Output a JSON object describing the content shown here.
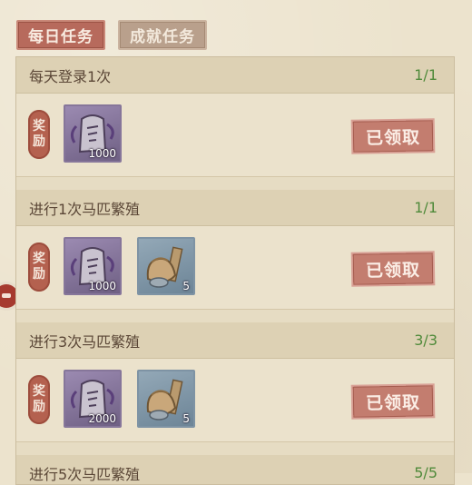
{
  "tabs": [
    {
      "label": "每日任务",
      "active": true
    },
    {
      "label": "成就任务",
      "active": false
    }
  ],
  "reward_label": [
    "奖",
    "励"
  ],
  "tasks": [
    {
      "title": "每天登录1次",
      "progress": "1/1",
      "status": "已领取",
      "rewards": [
        {
          "icon": "purple-token-icon",
          "count": "1000"
        }
      ]
    },
    {
      "title": "进行1次马匹繁殖",
      "progress": "1/1",
      "status": "已领取",
      "rewards": [
        {
          "icon": "purple-token-icon",
          "count": "1000"
        },
        {
          "icon": "feed-sack-icon",
          "count": "5"
        }
      ]
    },
    {
      "title": "进行3次马匹繁殖",
      "progress": "3/3",
      "status": "已领取",
      "rewards": [
        {
          "icon": "purple-token-icon",
          "count": "2000"
        },
        {
          "icon": "feed-sack-icon",
          "count": "5"
        }
      ]
    },
    {
      "title": "进行5次马匹繁殖",
      "progress": "5/5"
    }
  ],
  "colors": {
    "accent": "#b76a5c",
    "progress": "#4f8a3a",
    "paper": "#ece3cd"
  }
}
